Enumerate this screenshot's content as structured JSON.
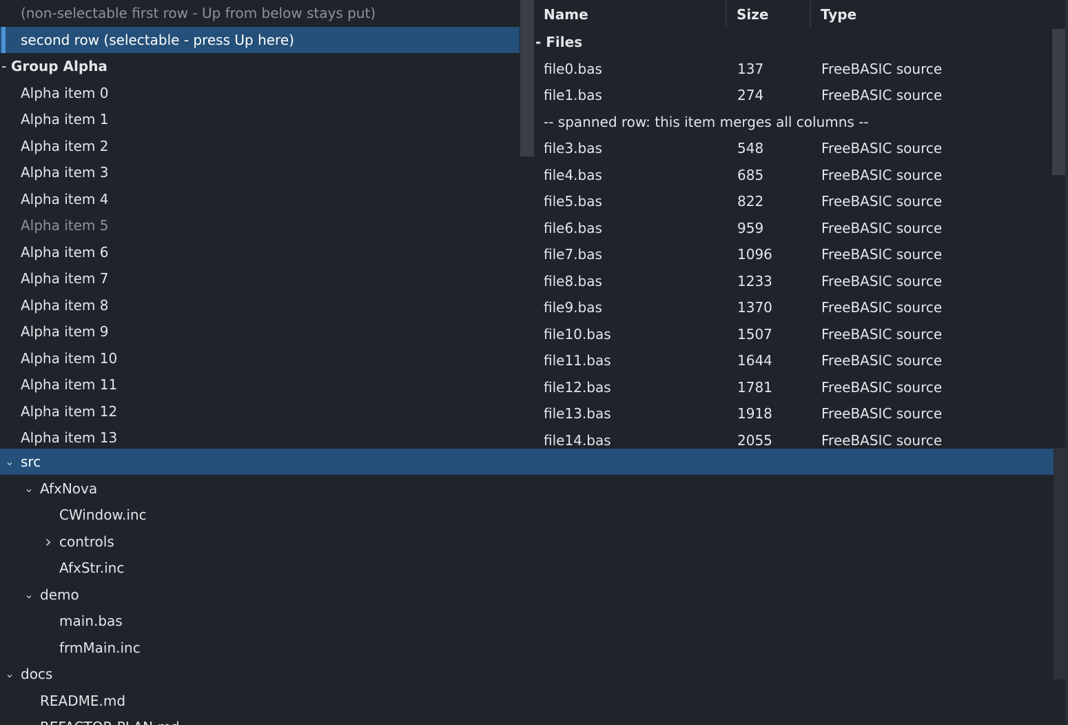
{
  "left_list": {
    "rows": [
      {
        "label": "(non-selectable first row - Up from below stays put)",
        "kind": "item",
        "state": "disabled"
      },
      {
        "label": "second row (selectable - press Up here)",
        "kind": "item",
        "state": "selected"
      },
      {
        "label": "Group Alpha",
        "kind": "group",
        "state": "expanded"
      },
      {
        "label": "Alpha item 0",
        "kind": "item"
      },
      {
        "label": "Alpha item 1",
        "kind": "item"
      },
      {
        "label": "Alpha item 2",
        "kind": "item"
      },
      {
        "label": "Alpha item 3",
        "kind": "item"
      },
      {
        "label": "Alpha item 4",
        "kind": "item"
      },
      {
        "label": "Alpha item 5",
        "kind": "item",
        "state": "disabled"
      },
      {
        "label": "Alpha item 6",
        "kind": "item"
      },
      {
        "label": "Alpha item 7",
        "kind": "item"
      },
      {
        "label": "Alpha item 8",
        "kind": "item"
      },
      {
        "label": "Alpha item 9",
        "kind": "item"
      },
      {
        "label": "Alpha item 10",
        "kind": "item"
      },
      {
        "label": "Alpha item 11",
        "kind": "item"
      },
      {
        "label": "Alpha item 12",
        "kind": "item"
      },
      {
        "label": "Alpha item 13",
        "kind": "item"
      }
    ]
  },
  "list_view": {
    "columns": [
      "Name",
      "Size",
      "Type"
    ],
    "group_label": "Files",
    "rows": [
      {
        "name": "file0.bas",
        "size": "137",
        "type": "FreeBASIC source"
      },
      {
        "name": "file1.bas",
        "size": "274",
        "type": "FreeBASIC source"
      },
      {
        "span": "-- spanned row: this item merges all columns --"
      },
      {
        "name": "file3.bas",
        "size": "548",
        "type": "FreeBASIC source"
      },
      {
        "name": "file4.bas",
        "size": "685",
        "type": "FreeBASIC source"
      },
      {
        "name": "file5.bas",
        "size": "822",
        "type": "FreeBASIC source"
      },
      {
        "name": "file6.bas",
        "size": "959",
        "type": "FreeBASIC source"
      },
      {
        "name": "file7.bas",
        "size": "1096",
        "type": "FreeBASIC source"
      },
      {
        "name": "file8.bas",
        "size": "1233",
        "type": "FreeBASIC source"
      },
      {
        "name": "file9.bas",
        "size": "1370",
        "type": "FreeBASIC source"
      },
      {
        "name": "file10.bas",
        "size": "1507",
        "type": "FreeBASIC source"
      },
      {
        "name": "file11.bas",
        "size": "1644",
        "type": "FreeBASIC source"
      },
      {
        "name": "file12.bas",
        "size": "1781",
        "type": "FreeBASIC source"
      },
      {
        "name": "file13.bas",
        "size": "1918",
        "type": "FreeBASIC source"
      },
      {
        "name": "file14.bas",
        "size": "2055",
        "type": "FreeBASIC source"
      }
    ]
  },
  "tree": {
    "nodes": [
      {
        "label": "src",
        "depth": 0,
        "expander": "expanded",
        "selected": true
      },
      {
        "label": "AfxNova",
        "depth": 1,
        "expander": "expanded"
      },
      {
        "label": "CWindow.inc",
        "depth": 2,
        "expander": "none"
      },
      {
        "label": "controls",
        "depth": 2,
        "expander": "collapsed"
      },
      {
        "label": "AfxStr.inc",
        "depth": 2,
        "expander": "none"
      },
      {
        "label": "demo",
        "depth": 1,
        "expander": "expanded"
      },
      {
        "label": "main.bas",
        "depth": 2,
        "expander": "none"
      },
      {
        "label": "frmMain.inc",
        "depth": 2,
        "expander": "none"
      },
      {
        "label": "docs",
        "depth": 0,
        "expander": "expanded"
      },
      {
        "label": "README.md",
        "depth": 1,
        "expander": "none"
      },
      {
        "label": "REFACTOR-PLAN.md",
        "depth": 1,
        "expander": "none"
      }
    ]
  },
  "colors": {
    "background": "#1f232a",
    "selection": "#245079",
    "focus_bar": "#4d93d8",
    "text": "#e3e7ec",
    "disabled_text": "#8d939c"
  }
}
